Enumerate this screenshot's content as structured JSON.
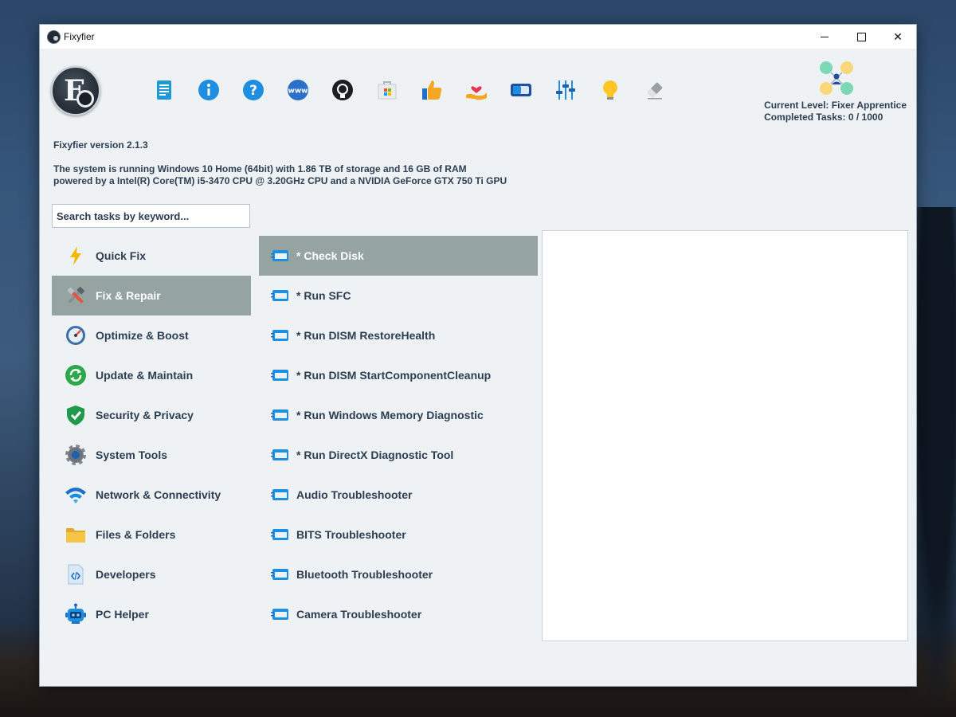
{
  "window": {
    "title": "Fixyfier"
  },
  "toolbar": {
    "icons": [
      "changelog-icon",
      "info-icon",
      "help-icon",
      "website-icon",
      "github-icon",
      "store-icon",
      "like-icon",
      "donate-icon",
      "toggle-view-icon",
      "settings-sliders-icon",
      "tips-bulb-icon",
      "eraser-icon"
    ]
  },
  "level": {
    "current": "Current Level: Fixer Apprentice",
    "completed": "Completed Tasks: 0 / 1000"
  },
  "version": "Fixyfier version 2.1.3",
  "sysinfo": {
    "line1": "The system is running Windows 10 Home (64bit) with 1.86 TB of storage and 16 GB of RAM",
    "line2": "powered by a Intel(R) Core(TM) i5-3470 CPU @ 3.20GHz CPU and a NVIDIA GeForce GTX 750 Ti GPU"
  },
  "search": {
    "placeholder": "Search tasks by keyword..."
  },
  "categories": [
    {
      "label": "Quick Fix",
      "icon": "lightning-icon"
    },
    {
      "label": "Fix & Repair",
      "icon": "tools-icon",
      "active": true
    },
    {
      "label": "Optimize & Boost",
      "icon": "speedometer-icon"
    },
    {
      "label": "Update & Maintain",
      "icon": "refresh-icon"
    },
    {
      "label": "Security & Privacy",
      "icon": "shield-check-icon"
    },
    {
      "label": "System Tools",
      "icon": "gear-icon"
    },
    {
      "label": "Network & Connectivity",
      "icon": "wifi-icon"
    },
    {
      "label": "Files & Folders",
      "icon": "folder-icon"
    },
    {
      "label": "Developers",
      "icon": "code-file-icon"
    },
    {
      "label": "PC Helper",
      "icon": "robot-icon"
    }
  ],
  "tasks": [
    {
      "label": "* Check Disk",
      "active": true
    },
    {
      "label": "* Run SFC"
    },
    {
      "label": "* Run DISM RestoreHealth"
    },
    {
      "label": "* Run DISM StartComponentCleanup"
    },
    {
      "label": "* Run Windows Memory Diagnostic"
    },
    {
      "label": "* Run DirectX Diagnostic Tool"
    },
    {
      "label": "Audio Troubleshooter"
    },
    {
      "label": "BITS Troubleshooter"
    },
    {
      "label": "Bluetooth Troubleshooter"
    },
    {
      "label": "Camera Troubleshooter"
    }
  ],
  "colors": {
    "accent_active": "#95a4a1",
    "text": "#2d3e52",
    "background": "#eef2f5"
  }
}
